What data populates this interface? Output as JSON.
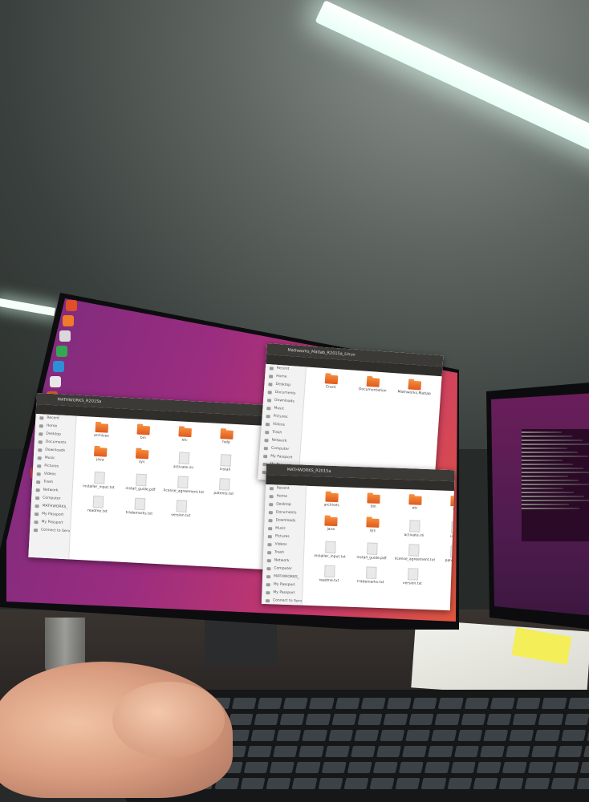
{
  "scene": {
    "description_free": true
  },
  "windows": {
    "win1": {
      "title": "MATHWORKS_R2015a",
      "sidebar": [
        "Recent",
        "Home",
        "Desktop",
        "Documents",
        "Downloads",
        "Music",
        "Pictures",
        "Videos",
        "Trash",
        "Network",
        "Computer",
        "MATHWORKS_",
        "My Passport",
        "My Passport",
        "Connect to Server"
      ],
      "files": [
        {
          "name": "archives",
          "type": "folder"
        },
        {
          "name": "bin",
          "type": "folder"
        },
        {
          "name": "etc",
          "type": "folder"
        },
        {
          "name": "help",
          "type": "folder"
        },
        {
          "name": "java",
          "type": "folder"
        },
        {
          "name": "sys",
          "type": "folder"
        },
        {
          "name": "activate.ini",
          "type": "doc"
        },
        {
          "name": "install",
          "type": "doc"
        },
        {
          "name": "installer_input.txt",
          "type": "doc"
        },
        {
          "name": "install_guide.pdf",
          "type": "doc"
        },
        {
          "name": "license_agreement.txt",
          "type": "doc"
        },
        {
          "name": "patents.txt",
          "type": "doc"
        },
        {
          "name": "readme.txt",
          "type": "doc"
        },
        {
          "name": "trademarks.txt",
          "type": "doc"
        },
        {
          "name": "version.txt",
          "type": "doc"
        }
      ]
    },
    "win2": {
      "title": "Mathworks_Matlab_R2015a_Linux",
      "sidebar": [
        "Recent",
        "Home",
        "Desktop",
        "Documents",
        "Downloads",
        "Music",
        "Pictures",
        "Videos",
        "Trash",
        "Network",
        "Computer",
        "My Passport",
        "My Passport",
        "Connect to Server"
      ],
      "files": [
        {
          "name": "Crack",
          "type": "folder"
        },
        {
          "name": "Documentation",
          "type": "folder"
        },
        {
          "name": "Mathworks.Matlab",
          "type": "folder"
        },
        {
          "name": "",
          "type": "doc"
        }
      ]
    },
    "win3": {
      "title": "MATHWORKS_R2015a",
      "sidebar": [
        "Recent",
        "Home",
        "Desktop",
        "Documents",
        "Downloads",
        "Music",
        "Pictures",
        "Videos",
        "Trash",
        "Network",
        "Computer",
        "MATHWORKS_",
        "My Passport",
        "My Passport",
        "Connect to Server"
      ],
      "files": [
        {
          "name": "archives",
          "type": "folder"
        },
        {
          "name": "bin",
          "type": "folder"
        },
        {
          "name": "etc",
          "type": "folder"
        },
        {
          "name": "help",
          "type": "folder"
        },
        {
          "name": "java",
          "type": "folder"
        },
        {
          "name": "sys",
          "type": "folder"
        },
        {
          "name": "activate.ini",
          "type": "doc"
        },
        {
          "name": "install",
          "type": "doc"
        },
        {
          "name": "installer_input.txt",
          "type": "doc"
        },
        {
          "name": "install_guide.pdf",
          "type": "doc"
        },
        {
          "name": "license_agreement.txt",
          "type": "doc"
        },
        {
          "name": "patents.txt",
          "type": "doc"
        },
        {
          "name": "readme.txt",
          "type": "doc"
        },
        {
          "name": "trademarks.txt",
          "type": "doc"
        },
        {
          "name": "version.txt",
          "type": "doc"
        }
      ]
    }
  },
  "launcher_colors": [
    "#e04e2a",
    "#f07b2a",
    "#d9d9d9",
    "#33a852",
    "#2d8fd5",
    "#e8e8e8",
    "#e0602a",
    "#f2f2f2",
    "#333333",
    "#e7e7e7",
    "#e7e7e7",
    "#d44"
  ],
  "colors": {
    "desktop_from": "#7a2b7e",
    "desktop_to": "#e0573e",
    "folder": "#e05a1e"
  }
}
